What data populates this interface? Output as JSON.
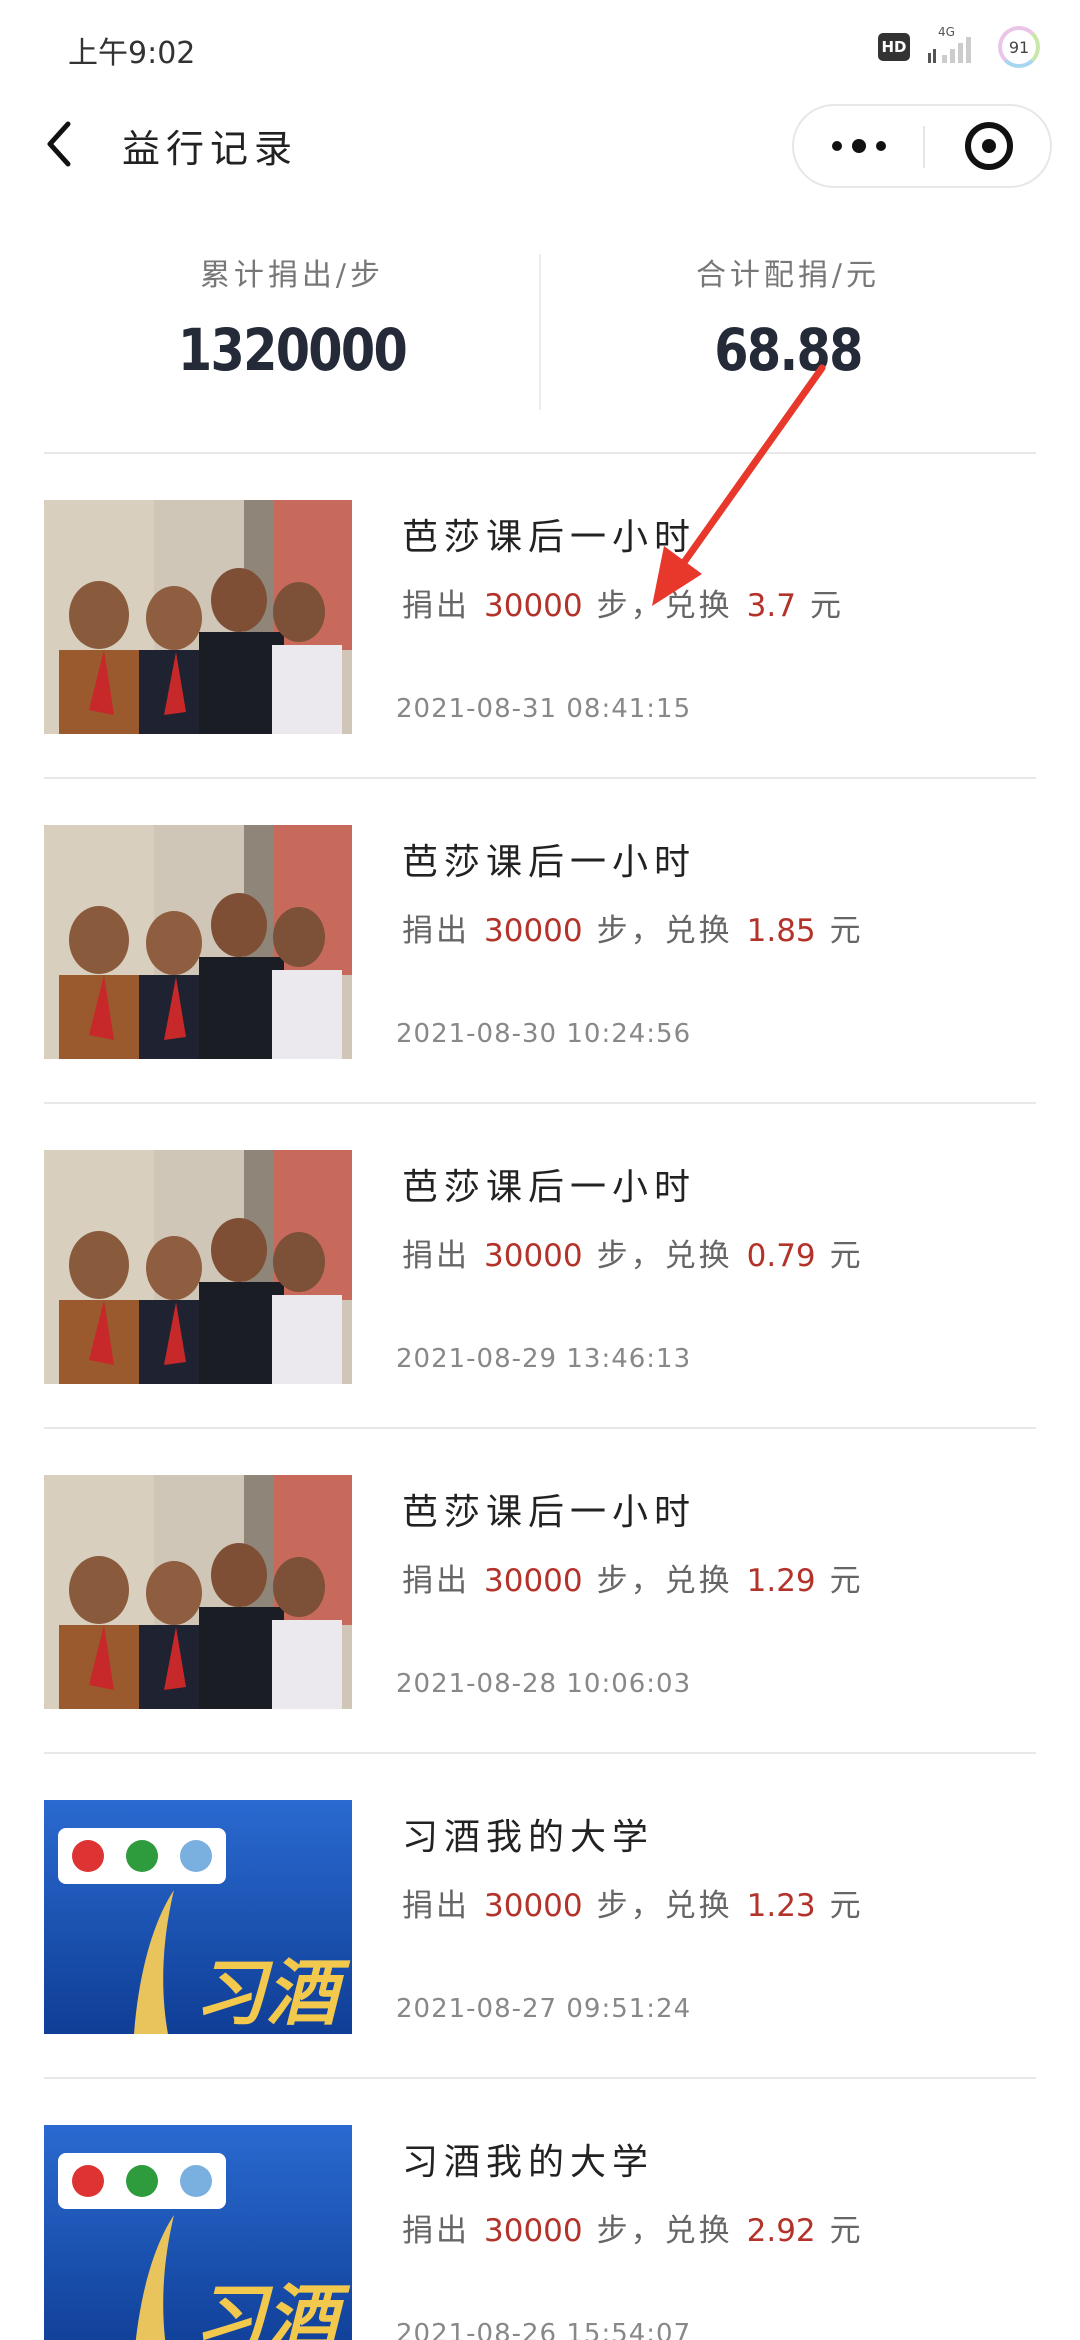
{
  "status_bar": {
    "time": "上午9:02",
    "hd_label": "HD",
    "network_label": "4G",
    "battery_level": "91"
  },
  "nav": {
    "title": "益行记录"
  },
  "summary": {
    "steps_label": "累计捐出/步",
    "steps_value": "1320000",
    "money_label": "合计配捐/元",
    "money_value": "68.88"
  },
  "records": [
    {
      "title": "芭莎课后一小时",
      "prefix": "捐出",
      "steps": "30000",
      "middle": "步，兑换",
      "amount": "3.7",
      "unit": "元",
      "time": "2021-08-31 08:41:15",
      "image": "children-photo"
    },
    {
      "title": "芭莎课后一小时",
      "prefix": "捐出",
      "steps": "30000",
      "middle": "步，兑换",
      "amount": "1.85",
      "unit": "元",
      "time": "2021-08-30 10:24:56",
      "image": "children-photo"
    },
    {
      "title": "芭莎课后一小时",
      "prefix": "捐出",
      "steps": "30000",
      "middle": "步，兑换",
      "amount": "0.79",
      "unit": "元",
      "time": "2021-08-29 13:46:13",
      "image": "children-photo"
    },
    {
      "title": "芭莎课后一小时",
      "prefix": "捐出",
      "steps": "30000",
      "middle": "步，兑换",
      "amount": "1.29",
      "unit": "元",
      "time": "2021-08-28 10:06:03",
      "image": "children-photo"
    },
    {
      "title": "习酒我的大学",
      "prefix": "捐出",
      "steps": "30000",
      "middle": "步，兑换",
      "amount": "1.23",
      "unit": "元",
      "time": "2021-08-27 09:51:24",
      "image": "xijiu-banner"
    },
    {
      "title": "习酒我的大学",
      "prefix": "捐出",
      "steps": "30000",
      "middle": "步，兑换",
      "amount": "2.92",
      "unit": "元",
      "time": "2021-08-26 15:54:07",
      "image": "xijiu-banner"
    }
  ],
  "banner_text": "习酒",
  "colors": {
    "accent_red": "#b3332b",
    "value_dark": "#252a38",
    "arrow_red": "#e8382c",
    "banner_blue": "#1b57b8"
  }
}
